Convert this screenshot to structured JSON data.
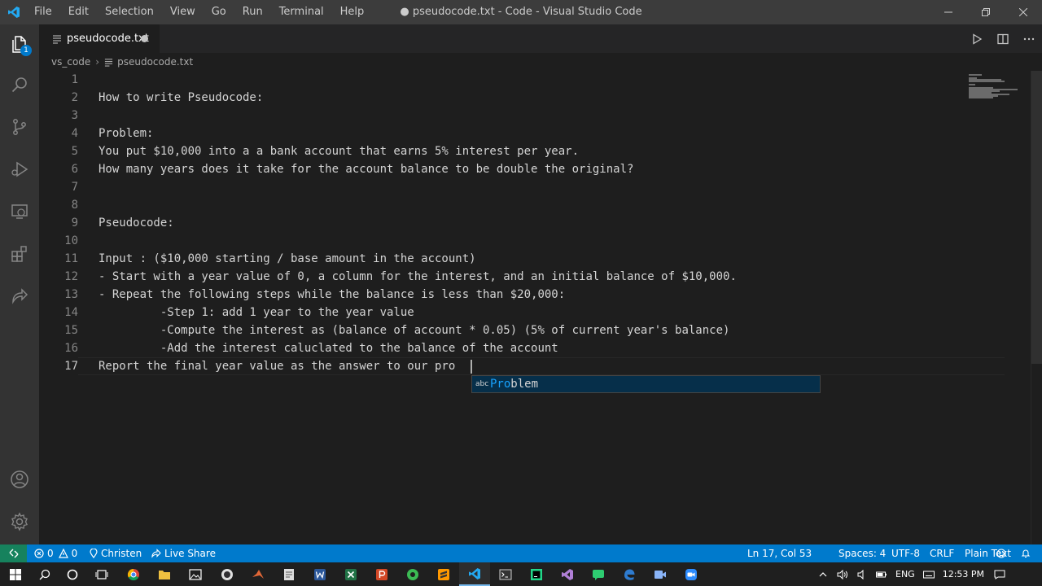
{
  "window": {
    "title": "● pseudocode.txt - Code - Visual Studio Code",
    "menu": [
      "File",
      "Edit",
      "Selection",
      "View",
      "Go",
      "Run",
      "Terminal",
      "Help"
    ]
  },
  "activity_bar": {
    "explorer_badge": "1"
  },
  "tab": {
    "label": "pseudocode.txt"
  },
  "breadcrumb": {
    "folder": "vs_code",
    "file": "pseudocode.txt"
  },
  "editor": {
    "line_numbers": [
      "1",
      "2",
      "3",
      "4",
      "5",
      "6",
      "7",
      "8",
      "9",
      "10",
      "11",
      "12",
      "13",
      "14",
      "15",
      "16",
      "17"
    ],
    "lines": [
      "",
      "How to write Pseudocode:",
      "",
      "Problem:",
      "You put $10,000 into a a bank account that earns 5% interest per year.",
      "How many years does it take for the account balance to be double the original?",
      "",
      "",
      "Pseudocode:",
      "",
      "Input : ($10,000 starting / base amount in the account)",
      "- Start with a year value of 0, a column for the interest, and an initial balance of $10,000.",
      "- Repeat the following steps while the balance is less than $20,000:",
      "         -Step 1: add 1 year to the year value",
      "         -Compute the interest as (balance of account * 0.05) (5% of current year's balance)",
      "         -Add the interest caluclated to the balance of the account",
      "Report the final year value as the answer to our pro"
    ]
  },
  "suggest": {
    "kind": "abc",
    "match": "Pro",
    "rest": "blem"
  },
  "status_bar": {
    "errors": "0",
    "warnings": "0",
    "user": "Christen",
    "live_share": "Live Share",
    "position": "Ln 17, Col 53",
    "spaces": "Spaces: 4",
    "encoding": "UTF-8",
    "eol": "CRLF",
    "language": "Plain Text"
  },
  "taskbar": {
    "language": "ENG",
    "time": "12:53 PM"
  },
  "colors": {
    "accent": "#007acc",
    "remote": "#16825d",
    "suggest_match": "#18a3ff"
  }
}
